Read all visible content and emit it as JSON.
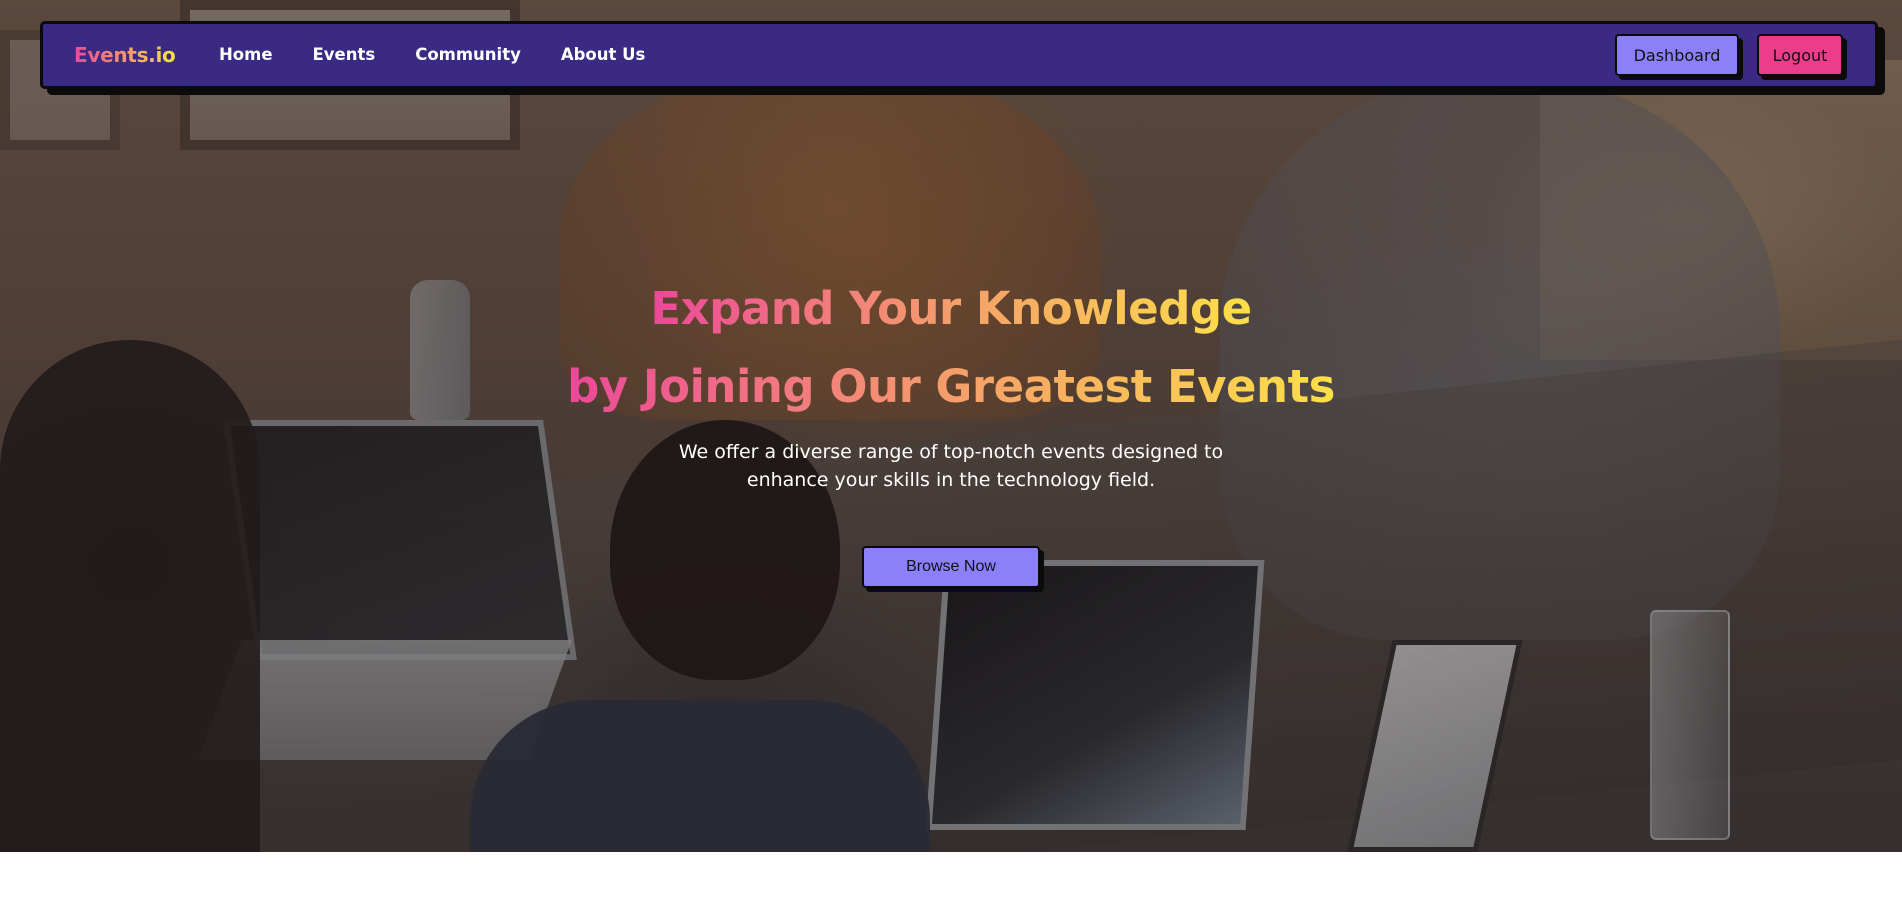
{
  "navbar": {
    "brand": "Events.io",
    "links": [
      "Home",
      "Events",
      "Community",
      "About Us"
    ],
    "dashboard_label": "Dashboard",
    "logout_label": "Logout"
  },
  "hero": {
    "headline_line1": "Expand Your Knowledge",
    "headline_line2": "by Joining Our Greatest Events",
    "subtext": "We offer a diverse range of top-notch events designed to enhance your skills in the technology field.",
    "cta_label": "Browse Now"
  },
  "colors": {
    "navbar_bg": "#3b2a84",
    "accent_purple": "#8b80f9",
    "accent_pink": "#ec3d8a",
    "gradient_start": "#ec4899",
    "gradient_end": "#fde047"
  }
}
